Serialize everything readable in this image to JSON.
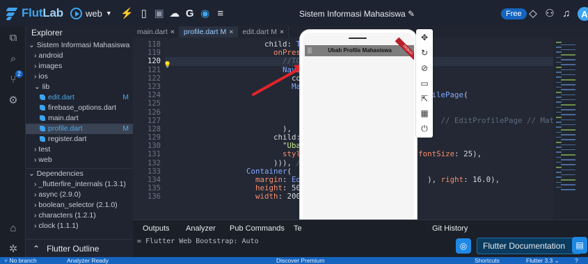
{
  "topbar": {
    "brand_a": "Flut",
    "brand_b": "Lab",
    "target": "web",
    "project_title": "Sistem Informasi Mahasiswa",
    "plan_badge": "Free",
    "avatar_letter": "A"
  },
  "explorer": {
    "title": "Explorer",
    "tree": [
      {
        "label": "Sistem Informasi Mahasiswa",
        "indent": 0,
        "arrow": "⌄"
      },
      {
        "label": "android",
        "indent": 1,
        "arrow": "›"
      },
      {
        "label": "images",
        "indent": 1,
        "arrow": "›"
      },
      {
        "label": "ios",
        "indent": 1,
        "arrow": "›"
      },
      {
        "label": "lib",
        "indent": 1,
        "arrow": "⌄"
      },
      {
        "label": "edit.dart",
        "indent": 2,
        "dart": true,
        "mark": "M",
        "color": "#4ea8e6"
      },
      {
        "label": "firebase_options.dart",
        "indent": 2,
        "dart": true
      },
      {
        "label": "main.dart",
        "indent": 2,
        "dart": true
      },
      {
        "label": "profile.dart",
        "indent": 2,
        "dart": true,
        "mark": "M",
        "active": true,
        "color": "#4ea8e6"
      },
      {
        "label": "register.dart",
        "indent": 2,
        "dart": true
      },
      {
        "label": "test",
        "indent": 1,
        "arrow": "›"
      },
      {
        "label": "web",
        "indent": 1,
        "arrow": "›"
      }
    ],
    "deps_title": "Dependencies",
    "deps": [
      "_flutterfire_internals (1.3.1)",
      "async (2.9.0)",
      "boolean_selector (2.1.0)",
      "characters (1.2.1)",
      "clock (1.1.1)"
    ],
    "outline_label": "Flutter Outline"
  },
  "tabs": [
    {
      "label": "main.dart",
      "active": false
    },
    {
      "label": "profile.dart M",
      "active": true
    },
    {
      "label": "edit.dart M",
      "active": false
    }
  ],
  "editor": {
    "current_line": "120",
    "lines": [
      {
        "n": "118",
        "html": "                      child: <span class='f'>TextButton</span>("
      },
      {
        "n": "119",
        "html": "                        <span class='p'>onPressed</span>: () {"
      },
      {
        "n": "120",
        "html": "                          <span class='c'>//TODO Upda</span>"
      },
      {
        "n": "121",
        "html": "                          <span class='f'>Navigator</span>.<span class='f'>p</span>"
      },
      {
        "n": "122",
        "html": "                            context,"
      },
      {
        "n": "123",
        "html": "                            <span class='f'>Materia</span>"
      },
      {
        "n": "124",
        "html": "                              <span class='p'>bui</span>                         <span class='f'>filePage</span>("
      },
      {
        "n": "125",
        "html": ""
      },
      {
        "n": "126",
        "html": ""
      },
      {
        "n": "127",
        "html": "                                                             <span class='c'>// EditProfilePage // Mater</span>"
      },
      {
        "n": "128",
        "html": "                          ),"
      },
      {
        "n": "129",
        "html": "                        child: <span class='f'>Text</span>("
      },
      {
        "n": "130",
        "html": "                          <span class='s'>\"Ubah Profi</span>"
      },
      {
        "n": "131",
        "html": "                          <span class='p'>style</span>: <span class='f'>Text</span>                   <span class='p'>fontSize</span>: 25),"
      },
      {
        "n": "132",
        "html": "                        ))), <span class='c'>// Text</span>"
      },
      {
        "n": "133",
        "html": "                  <span class='f'>Container</span>("
      },
      {
        "n": "134",
        "html": "                    <span class='p'>margin</span>: <span class='f'>EdgeInset</span>                     ), <span class='p'>right</span>: 16.0),"
      },
      {
        "n": "135",
        "html": "                    <span class='p'>height</span>: 50,"
      },
      {
        "n": "136",
        "html": "                    <span class='p'>width</span>: 200,"
      }
    ]
  },
  "preview": {
    "appbar_title": "Ubah Profile Mahasiswa",
    "debug_label": "DEBUG"
  },
  "panel": {
    "tabs": [
      "Outputs",
      "Analyzer",
      "Pub Commands",
      "Te",
      "Git History"
    ],
    "console_line": "= Flutter Web Bootstrap: Auto",
    "flutter_docs": "Flutter Documentation"
  },
  "status": {
    "branch": "No branch",
    "analyzer": "Analyzer Ready",
    "center": "Discover Premium",
    "shortcuts": "Shortcuts",
    "flutter_version": "Flutter 3.3"
  },
  "colors": {
    "accent": "#3ea4f0",
    "status_bar": "#1565c0",
    "editor_bg": "#232834"
  }
}
